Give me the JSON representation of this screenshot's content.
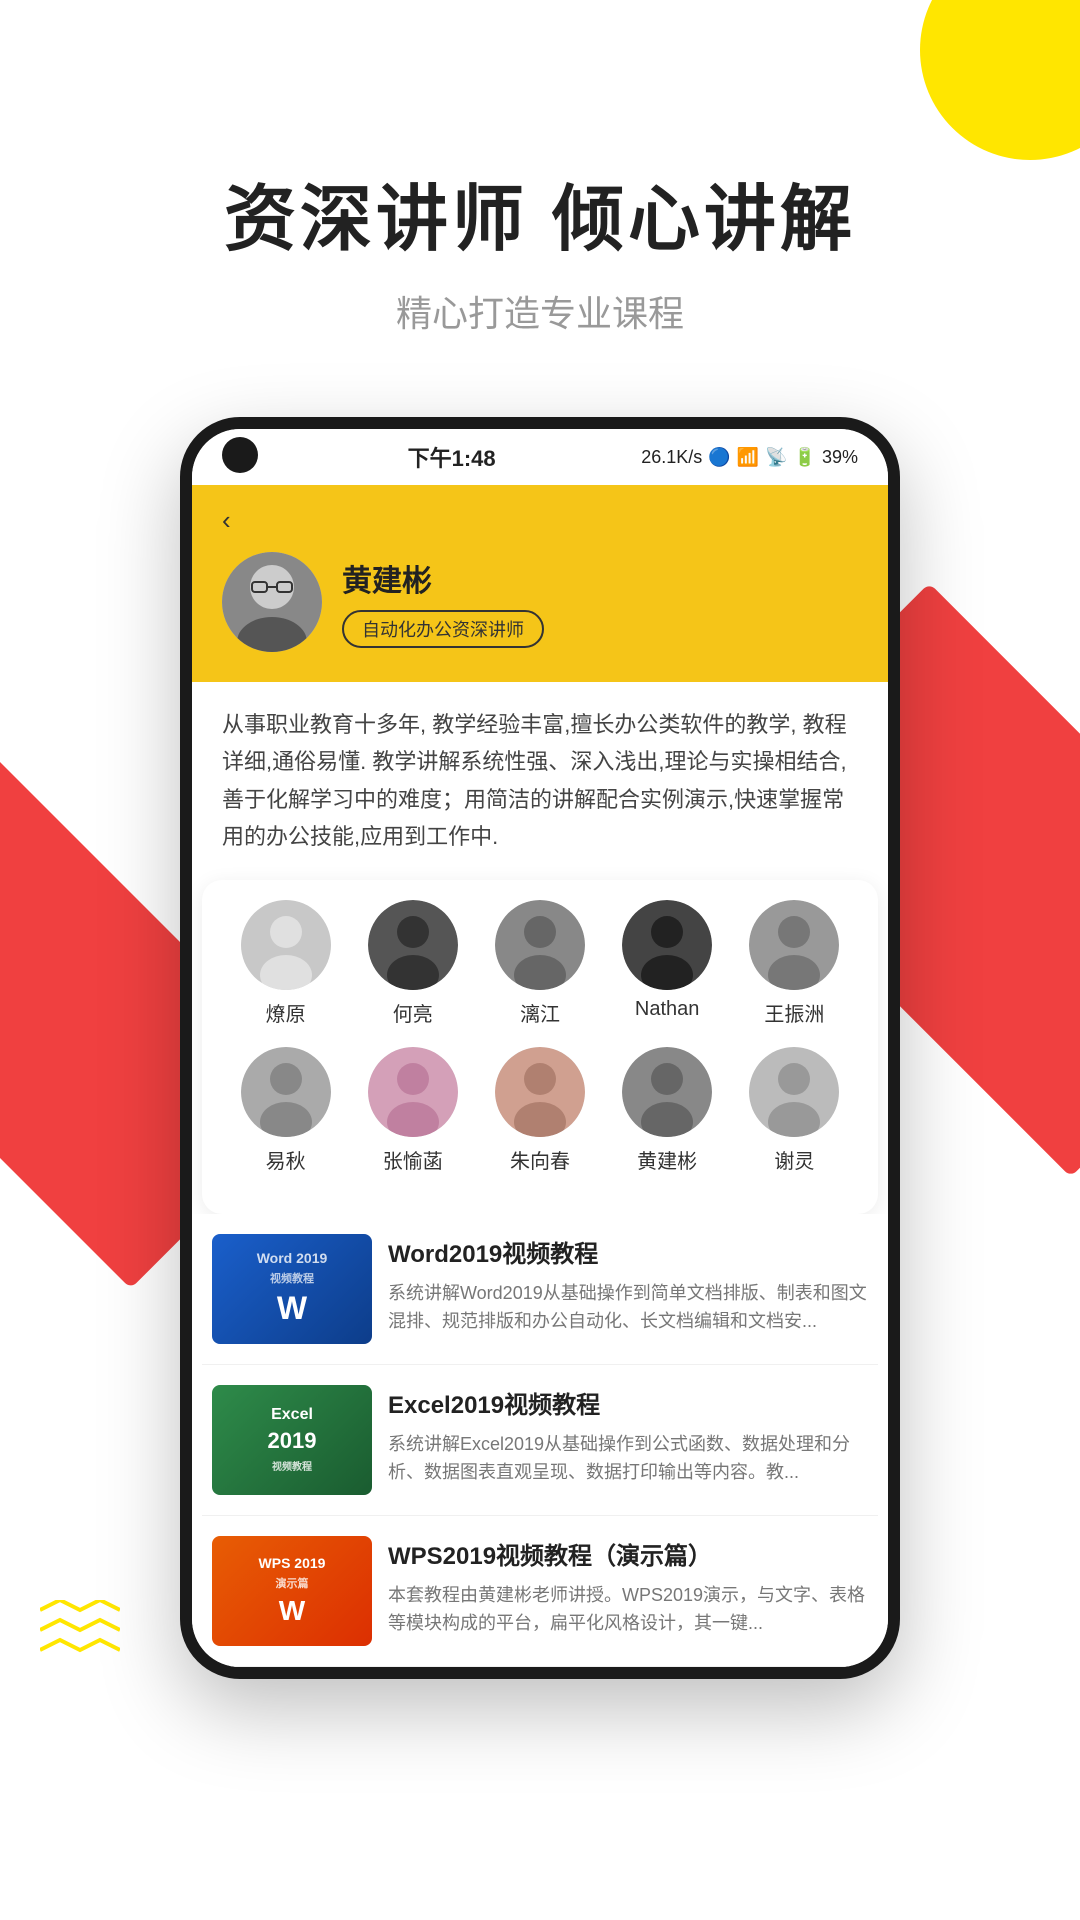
{
  "hero": {
    "title": "资深讲师  倾心讲解",
    "subtitle": "精心打造专业课程"
  },
  "status_bar": {
    "time": "下午1:48",
    "network": "26.1K/s",
    "battery": "39%"
  },
  "instructor_main": {
    "name": "黄建彬",
    "badge": "自动化办公资深讲师",
    "description": "从事职业教育十多年, 教学经验丰富,擅长办公类软件的教学, 教程详细,通俗易懂. 教学讲解系统性强、深入浅出,理论与实操相结合,善于化解学习中的难度；用简洁的讲解配合实例演示,快速掌握常用的办公技能,应用到工作中.",
    "back_label": "‹"
  },
  "instructors": {
    "row1": [
      {
        "name": "燎原",
        "color": "#b0b0b0"
      },
      {
        "name": "何亮",
        "color": "#555"
      },
      {
        "name": "漓江",
        "color": "#888"
      },
      {
        "name": "Nathan",
        "color": "#333"
      },
      {
        "name": "王振洲",
        "color": "#999"
      }
    ],
    "row2": [
      {
        "name": "易秋",
        "color": "#aaa"
      },
      {
        "name": "张愉菡",
        "color": "#c084a0"
      },
      {
        "name": "朱向春",
        "color": "#d0a090"
      },
      {
        "name": "黄建彬",
        "color": "#777"
      },
      {
        "name": "谢灵",
        "color": "#bbb"
      }
    ]
  },
  "courses": [
    {
      "title": "Word2019视频教程",
      "desc": "系统讲解Word2019从基础操作到简单文档排版、制表和图文混排、规范排版和办公自动化、长文档编辑和文档安...",
      "type": "word",
      "thumb_label": "Word 2019",
      "thumb_sublabel": "视频教程"
    },
    {
      "title": "Excel2019视频教程",
      "desc": "系统讲解Excel2019从基础操作到公式函数、数据处理和分析、数据图表直观呈现、数据打印输出等内容。教...",
      "type": "excel",
      "thumb_label": "Excel",
      "thumb_sublabel": "2019"
    },
    {
      "title": "WPS2019视频教程（演示篇）",
      "desc": "本套教程由黄建彬老师讲授。WPS2019演示，与文字、表格等模块构成的平台，扁平化风格设计，其一键...",
      "type": "wps",
      "thumb_label": "WPS 2019",
      "thumb_sublabel": "演示篇"
    }
  ]
}
